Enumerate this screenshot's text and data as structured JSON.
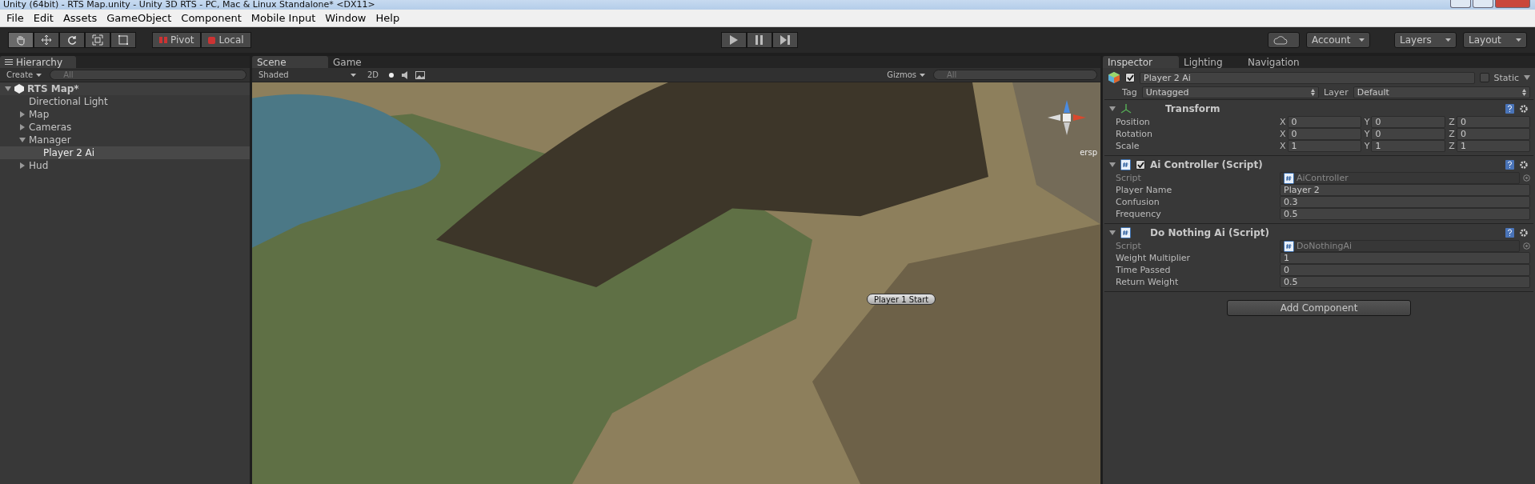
{
  "window": {
    "title": "Unity (64bit) - RTS Map.unity - Unity 3D RTS - PC, Mac & Linux Standalone* <DX11>"
  },
  "menu": [
    "File",
    "Edit",
    "Assets",
    "GameObject",
    "Component",
    "Mobile Input",
    "Window",
    "Help"
  ],
  "toolbar": {
    "tools": [
      {
        "kind": "hand",
        "selected": true
      },
      {
        "kind": "move",
        "selected": false
      },
      {
        "kind": "rotate",
        "selected": false
      },
      {
        "kind": "scale",
        "selected": false
      },
      {
        "kind": "rect",
        "selected": false
      }
    ],
    "pivot": "Pivot",
    "local": "Local",
    "account": "Account",
    "layers": "Layers",
    "layout": "Layout"
  },
  "hierarchy": {
    "tab": "Hierarchy",
    "create": "Create",
    "search": {
      "placeholder": "All"
    },
    "scene": "RTS Map*",
    "items": [
      {
        "label": "Directional Light",
        "selected": false
      },
      {
        "label": "Map",
        "expanded": false,
        "selected": false
      },
      {
        "label": "Cameras",
        "expanded": false,
        "selected": false
      },
      {
        "label": "Manager",
        "expanded": true,
        "selected": false,
        "children": [
          {
            "label": "Player 2 Ai",
            "selected": true
          }
        ]
      },
      {
        "label": "Hud",
        "expanded": false,
        "selected": false
      }
    ]
  },
  "scene_view": {
    "tabs": [
      {
        "label": "Scene",
        "selected": true
      },
      {
        "label": "Game",
        "selected": false
      }
    ],
    "shading": "Shaded",
    "mode_2d": "2D",
    "gizmos": "Gizmos",
    "search": {
      "placeholder": "All"
    },
    "persp": "ersp",
    "marker": "Player 1 Start"
  },
  "inspector": {
    "tabs": [
      {
        "label": "Inspector",
        "selected": true
      },
      {
        "label": "Lighting",
        "selected": false
      },
      {
        "label": "Navigation",
        "selected": false
      }
    ],
    "object_name": "Player 2 Ai",
    "active": true,
    "static_label": "Static",
    "static": false,
    "tag_label": "Tag",
    "tag": "Untagged",
    "layer_label": "Layer",
    "layer": "Default",
    "components": [
      {
        "kind": "transform",
        "title": "Transform",
        "rows": [
          {
            "label": "Position",
            "values": [
              {
                "axis": "X",
                "value": "0"
              },
              {
                "axis": "Y",
                "value": "0"
              },
              {
                "axis": "Z",
                "value": "0"
              }
            ]
          },
          {
            "label": "Rotation",
            "values": [
              {
                "axis": "X",
                "value": "0"
              },
              {
                "axis": "Y",
                "value": "0"
              },
              {
                "axis": "Z",
                "value": "0"
              }
            ]
          },
          {
            "label": "Scale",
            "values": [
              {
                "axis": "X",
                "value": "1"
              },
              {
                "axis": "Y",
                "value": "1"
              },
              {
                "axis": "Z",
                "value": "1"
              }
            ]
          }
        ]
      },
      {
        "kind": "script",
        "title": "Ai Controller (Script)",
        "enabled": true,
        "script_label": "Script",
        "script": "AiController",
        "fields": [
          {
            "label": "Player Name",
            "value": "Player 2"
          },
          {
            "label": "Confusion",
            "value": "0.3"
          },
          {
            "label": "Frequency",
            "value": "0.5"
          }
        ]
      },
      {
        "kind": "script",
        "title": "Do Nothing Ai (Script)",
        "script_label": "Script",
        "script": "DoNothingAi",
        "fields": [
          {
            "label": "Weight Multiplier",
            "value": "1"
          },
          {
            "label": "Time Passed",
            "value": "0"
          },
          {
            "label": "Return Weight",
            "value": "0.5"
          }
        ]
      }
    ],
    "add_component": "Add Component"
  }
}
